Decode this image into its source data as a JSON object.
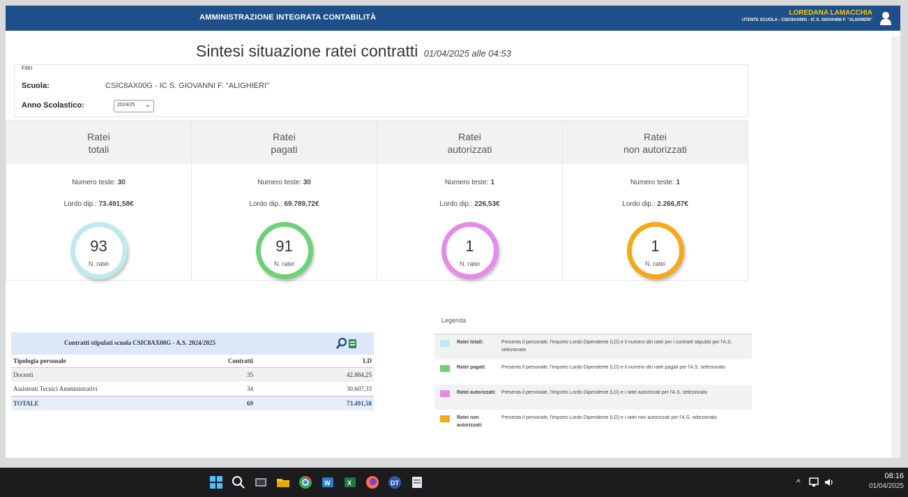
{
  "header": {
    "app_title": "AMMINISTRAZIONE INTEGRATA CONTABILITÀ",
    "user_name": "LOREDANA LAMACCHIA",
    "user_role": "UTENTE SCUOLA - CSIC8AX00G - IC S. GIOVANNI F. \"ALIGHIERI\"",
    "colors": {
      "bar": "#1f4f88",
      "user_name": "#f5c518"
    }
  },
  "page": {
    "title": "Sintesi situazione ratei contratti",
    "timestamp": "01/04/2025 alle 04:53"
  },
  "filters": {
    "section_label": "Filtri",
    "school_label": "Scuola:",
    "school_value": "CSIC8AX00G - IC S. GIOVANNI F. \"ALIGHIERI\"",
    "year_label": "Anno Scolastico:",
    "year_value": "2024/25"
  },
  "cards": [
    {
      "title_line1": "Ratei",
      "title_line2": "totali",
      "teste_label": "Numero teste:",
      "teste_value": "30",
      "lordo_label": "Lordo dip.:",
      "lordo_value": "73.491,58€",
      "count": "93",
      "count_label": "N. ratei",
      "color": "#bfe9ee"
    },
    {
      "title_line1": "Ratei",
      "title_line2": "pagati",
      "teste_label": "Numero teste:",
      "teste_value": "30",
      "lordo_label": "Lordo dip.:",
      "lordo_value": "69.789,72€",
      "count": "91",
      "count_label": "N. ratei",
      "color": "#6fd07a"
    },
    {
      "title_line1": "Ratei",
      "title_line2": "autorizzati",
      "teste_label": "Numero teste:",
      "teste_value": "1",
      "lordo_label": "Lordo dip.:",
      "lordo_value": "226,53€",
      "count": "1",
      "count_label": "N. ratei",
      "color": "#e58be8"
    },
    {
      "title_line1": "Ratei",
      "title_line2": "non autorizzati",
      "teste_label": "Numero teste:",
      "teste_value": "1",
      "lordo_label": "Lordo dip.:",
      "lordo_value": "2.266,87€",
      "count": "1",
      "count_label": "N. ratei",
      "color": "#f5a818"
    }
  ],
  "contracts_table": {
    "title": "Contratti stipulati scuola CSIC8AX00G - A.S. 2024/2025",
    "columns": [
      "Tipologia personale",
      "Contratti",
      "LD"
    ],
    "rows": [
      {
        "tipo": "Docenti",
        "contratti": "35",
        "ld": "42.884,25"
      },
      {
        "tipo": "Assistenti Tecnici Amministrativi",
        "contratti": "34",
        "ld": "30.607,33"
      }
    ],
    "total": {
      "tipo": "TOTALE",
      "contratti": "69",
      "ld": "73.491,58"
    }
  },
  "legend": {
    "title": "Legenda",
    "items": [
      {
        "name": "Ratei totali:",
        "desc": "Presenta il personale, l'importo Lordo Dipendente (LD) e il numero dei ratei per i contratti stipulati per l'A.S. selezionato",
        "color": "#bfe9ee"
      },
      {
        "name": "Ratei pagati:",
        "desc": "Presenta il personale, l'importo Lordo Dipendente (LD) e il numero dei ratei pagati per l'A.S. selezionato",
        "color": "#6fd07a"
      },
      {
        "name": "Ratei autorizzati:",
        "desc": "Presenta il personale, l'importo Lordo Dipendente (LD) e i ratei autorizzati per l'A.S. selezionato",
        "color": "#e58be8"
      },
      {
        "name": "Ratei non autorizzati:",
        "desc": "Presenta il personale, l'importo Lordo Dipendente (LD) e i ratei non autorizzati per l'A.S. selezionato",
        "color": "#f5a818"
      }
    ]
  },
  "taskbar": {
    "icons": [
      "windows-start-icon",
      "search-icon",
      "task-view-icon",
      "file-explorer-icon",
      "chrome-icon",
      "word-icon",
      "excel-icon",
      "firefox-icon",
      "dt-app-icon",
      "notepad-icon"
    ],
    "time": "08:16",
    "date": "01/04/2025"
  }
}
